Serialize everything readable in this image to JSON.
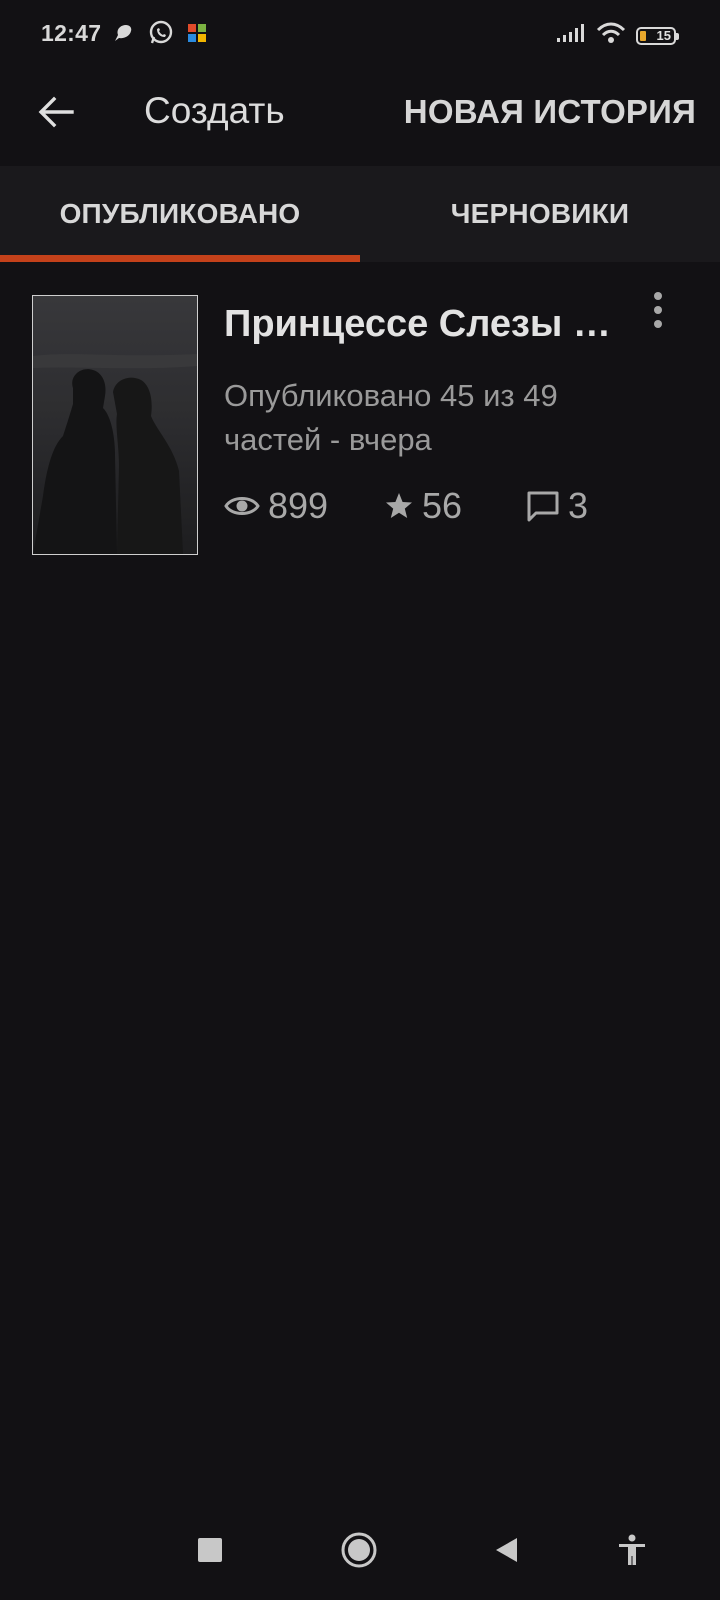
{
  "status_bar": {
    "time": "12:47",
    "battery_level": "15",
    "left_icons": [
      "messenger-icon",
      "whatsapp-icon",
      "microsoft-app-icon"
    ],
    "right_icons": [
      "signal-icon",
      "wifi-icon",
      "battery-icon"
    ]
  },
  "appbar": {
    "title": "Создать",
    "new_story_label": "НОВАЯ ИСТОРИЯ"
  },
  "tabs": [
    {
      "label": "ОПУБЛИКОВАНО",
      "active": true
    },
    {
      "label": "ЧЕРНОВИКИ",
      "active": false
    }
  ],
  "stories": [
    {
      "title": "Принцессе Слезы …",
      "meta_line1": "Опубликовано 45 из 49",
      "meta_line2": "частей - вчера",
      "views": "899",
      "votes": "56",
      "comments": "3"
    }
  ],
  "colors": {
    "background": "#121114",
    "tab_bar": "#1a191c",
    "accent": "#c4411a",
    "secondary_text": "#9a9a9a"
  }
}
